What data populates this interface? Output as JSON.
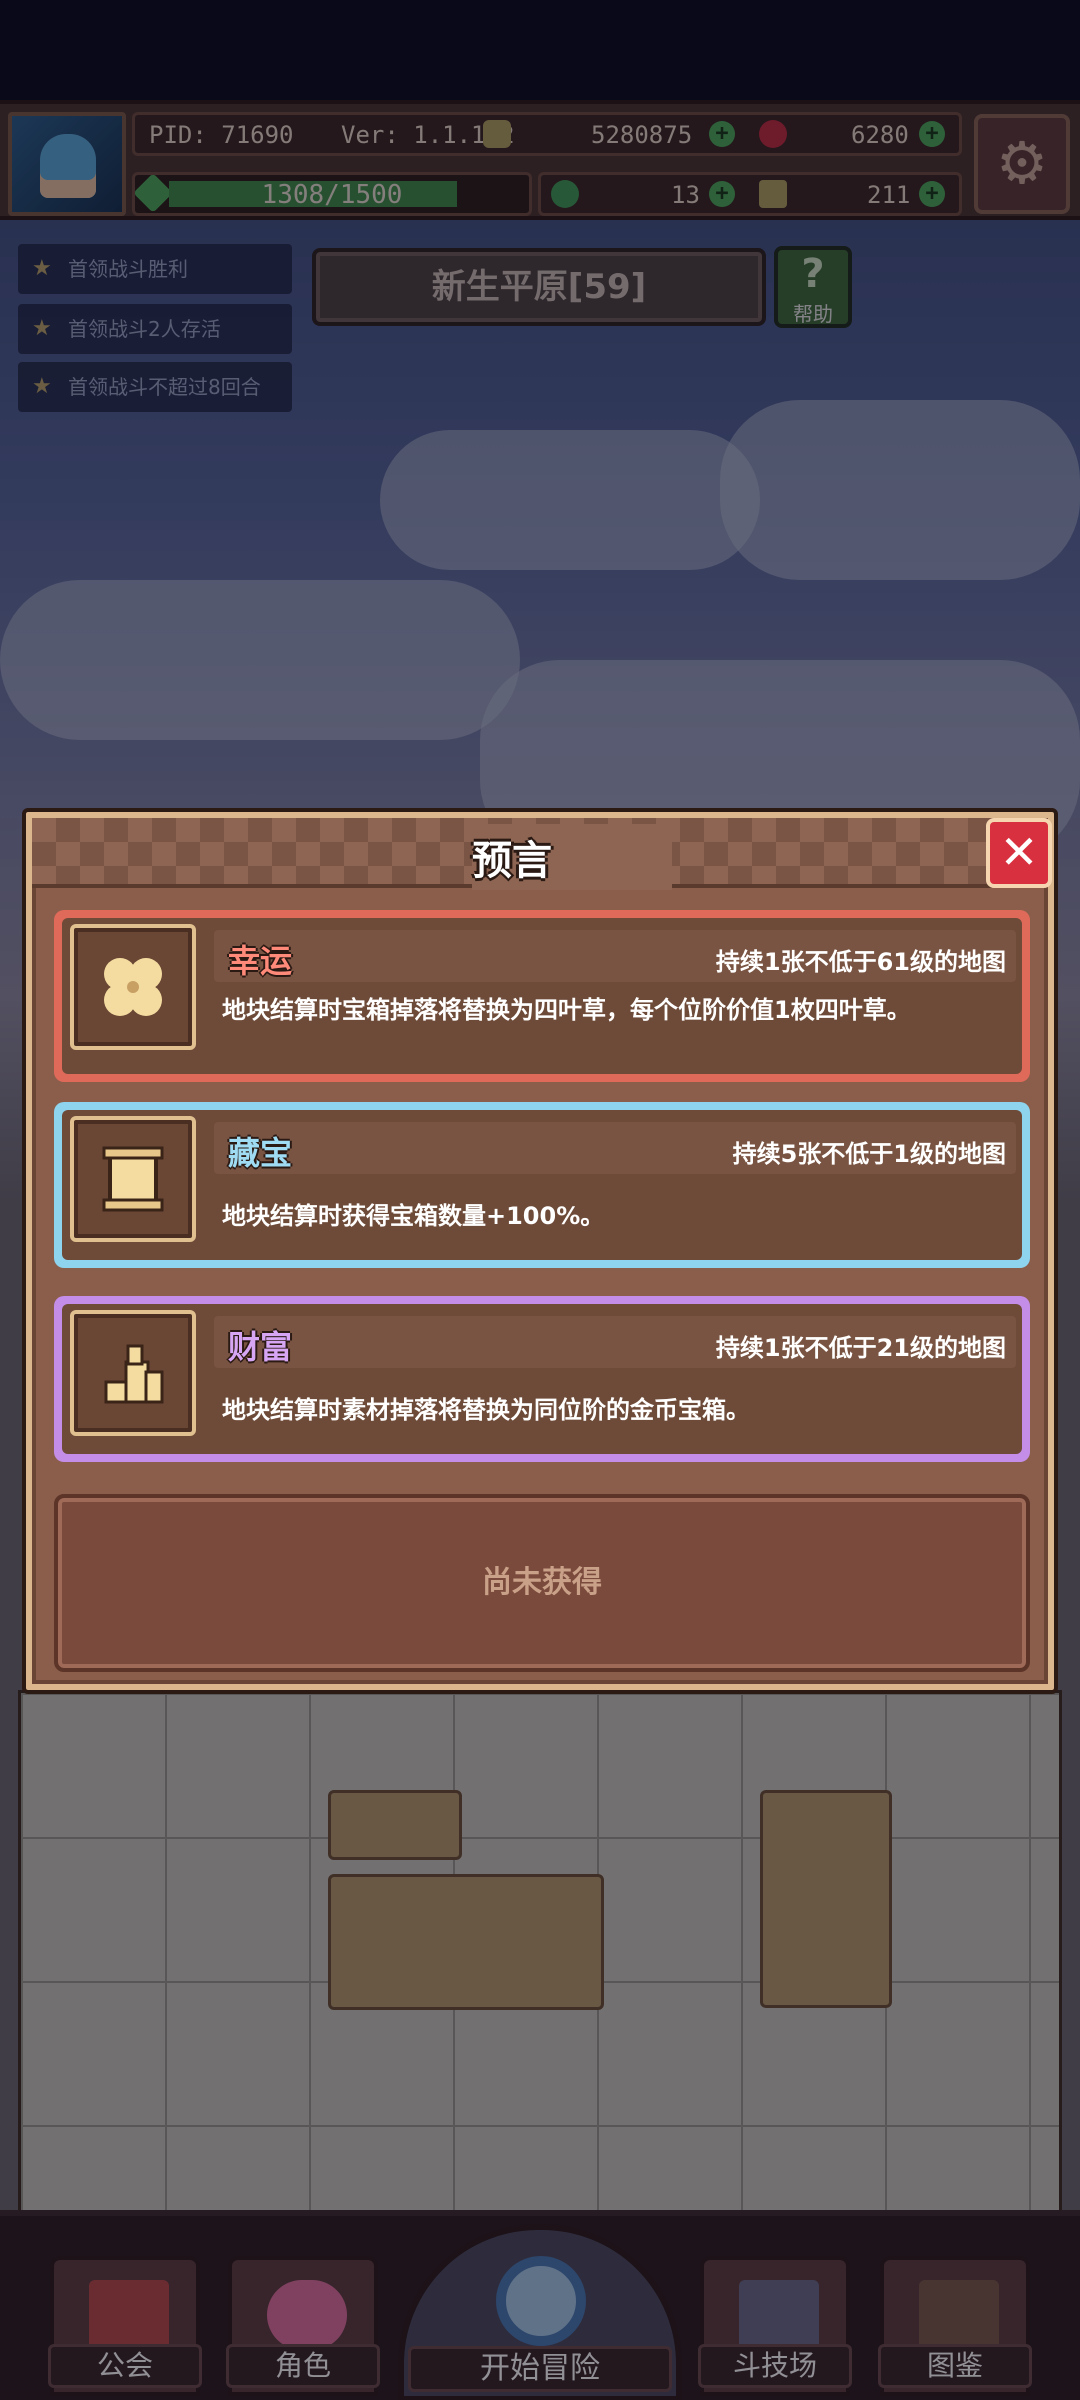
{
  "hud": {
    "pid_label": "PID: 71690",
    "version_label": "Ver: 1.1.1.2",
    "gold": "5280875",
    "gems": "6280",
    "exp_text": "1308/1500",
    "exp_progress": 0.872,
    "clover": "13",
    "material": "211",
    "settings_icon": "gear-icon"
  },
  "quests": [
    {
      "label": "首领战斗胜利"
    },
    {
      "label": "首领战斗2人存活"
    },
    {
      "label": "首领战斗不超过8回合"
    }
  ],
  "map": {
    "title": "新生平原[59]",
    "help_label": "帮助"
  },
  "modal": {
    "title": "预言",
    "close_icon": "close-icon",
    "cards": [
      {
        "name": "幸运",
        "duration": "持续1张不低于61级的地图",
        "desc": "地块结算时宝箱掉落将替换为四叶草，每个位阶价值1枚四叶草。",
        "border_color": "#e06a5a",
        "name_color": "#ff8a7a",
        "icon": "clover-icon"
      },
      {
        "name": "藏宝",
        "duration": "持续5张不低于1级的地图",
        "desc": "地块结算时获得宝箱数量+100%。",
        "border_color": "#8fd4ee",
        "name_color": "#9fdcf4",
        "icon": "scroll-icon"
      },
      {
        "name": "财富",
        "duration": "持续1张不低于21级的地图",
        "desc": "地块结算时素材掉落将替换为同位阶的金币宝箱。",
        "border_color": "#c48ee8",
        "name_color": "#d6a6f4",
        "icon": "coin-stack-icon"
      }
    ],
    "not_obtained": "尚未获得"
  },
  "nav": {
    "guild": "公会",
    "character": "角色",
    "start_adventure": "开始冒险",
    "arena": "斗技场",
    "codex": "图鉴"
  }
}
